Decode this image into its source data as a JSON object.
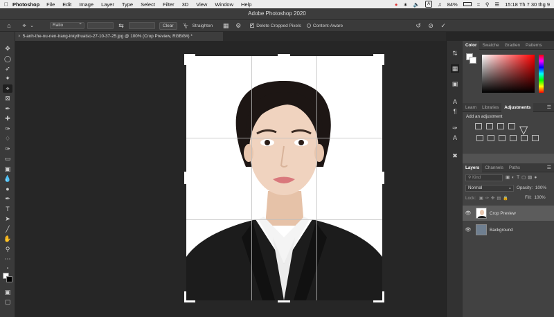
{
  "menubar": {
    "apple_icon": "apple-icon",
    "app_name": "Photoshop",
    "items": [
      "File",
      "Edit",
      "Image",
      "Layer",
      "Type",
      "Select",
      "Filter",
      "3D",
      "View",
      "Window",
      "Help"
    ],
    "battery": "84%",
    "keyboard_badge": "A",
    "clock": "15:18 Th 7 30 thg 9"
  },
  "window": {
    "title": "Adobe Photoshop 2020"
  },
  "options_bar": {
    "ratio_select": "Ratio",
    "clear_label": "Clear",
    "straighten_label": "Straighten",
    "delete_cropped_label": "Delete Cropped Pixels",
    "delete_cropped_checked": true,
    "content_aware_label": "Content-Aware"
  },
  "document": {
    "tab_title": "5-anh-the-nu-nen-trang-inkythuatso-27-10-37-25.jpg @ 100% (Crop Preview, RGB/8#) *"
  },
  "panels": {
    "color_tabs": [
      "Color",
      "Swatche",
      "Gradien",
      "Patterns"
    ],
    "adjust_tabs": [
      "Learn",
      "Libraries",
      "Adjustments"
    ],
    "add_adjustment": "Add an adjustment",
    "layers_tabs": [
      "Layers",
      "Channels",
      "Paths"
    ],
    "kind_placeholder": "Kind",
    "blend_mode": "Normal",
    "opacity_label": "Opacity:",
    "opacity_value": "100%",
    "lock_label": "Lock:",
    "fill_label": "Fill:",
    "fill_value": "100%",
    "layers": [
      {
        "name": "Crop Preview",
        "selected": true
      },
      {
        "name": "Background",
        "selected": false
      }
    ]
  },
  "colors": {
    "accent": "#ffffff",
    "suit": "#1c1c1c",
    "panel_bg": "#424242"
  }
}
